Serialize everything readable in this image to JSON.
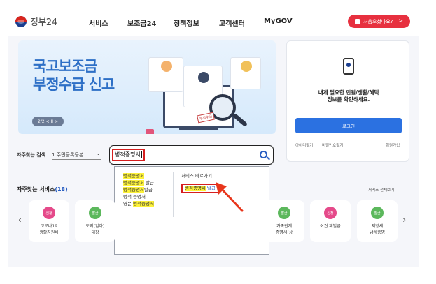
{
  "header": {
    "logo_text": "정부24",
    "nav": [
      "서비스",
      "보조금24",
      "정책정보",
      "고객센터",
      "MyGOV"
    ],
    "welcome_button": "처음오셨나요?",
    "welcome_chevron": ">"
  },
  "banner": {
    "title_line1": "국고보조금",
    "title_line2": "부정수급 신고",
    "pager": "2/2 < II >",
    "stamp_text": "부정수급"
  },
  "search": {
    "label": "자주찾는 검색",
    "selected_keyword": "1 주민등록등본",
    "query": "병적증명서"
  },
  "dropdown": {
    "suggestions": [
      {
        "prefix": "",
        "match": "병적증명서",
        "suffix": ""
      },
      {
        "prefix": "",
        "match": "병적증명서",
        "suffix": " 발급"
      },
      {
        "prefix": "",
        "match": "병적증명서",
        "suffix": "발급"
      },
      {
        "prefix": "병적 증명서",
        "match": "",
        "suffix": ""
      },
      {
        "prefix": "영문 ",
        "match": "병적증명서",
        "suffix": ""
      }
    ],
    "shortcut_heading": "서비스 바로가기",
    "shortcut_match": "병적증명서",
    "shortcut_badge": "발급"
  },
  "login": {
    "message_line1": "내게 필요한 민원/생활/혜택",
    "message_line2": "정보를 확인하세요.",
    "button": "로그인",
    "link_find_id": "아이디찾기",
    "link_find_pw": "비밀번호찾기",
    "link_signup": "회원가입"
  },
  "services": {
    "title": "자주찾는 서비스",
    "count": "(18)",
    "view_all": "서비스 전체보기",
    "items": [
      {
        "badge": "신청",
        "label": "코로나19\n생활지원비",
        "color": "#e54a8a"
      },
      {
        "badge": "발급",
        "label": "토지(임야)\n대장",
        "color": "#5cb85c"
      },
      {
        "badge": "발급",
        "label": "가족관계\n증명서(상",
        "color": "#5cb85c"
      },
      {
        "badge": "신청",
        "label": "여권 재발급",
        "color": "#e54a8a"
      },
      {
        "badge": "발급",
        "label": "지방세\n납세증명",
        "color": "#5cb85c"
      }
    ]
  },
  "colors": {
    "brand_red": "#e7303f",
    "primary_blue": "#2b71e1",
    "highlight_yellow": "#fdf23a",
    "annotation_red": "#d61f1f"
  }
}
